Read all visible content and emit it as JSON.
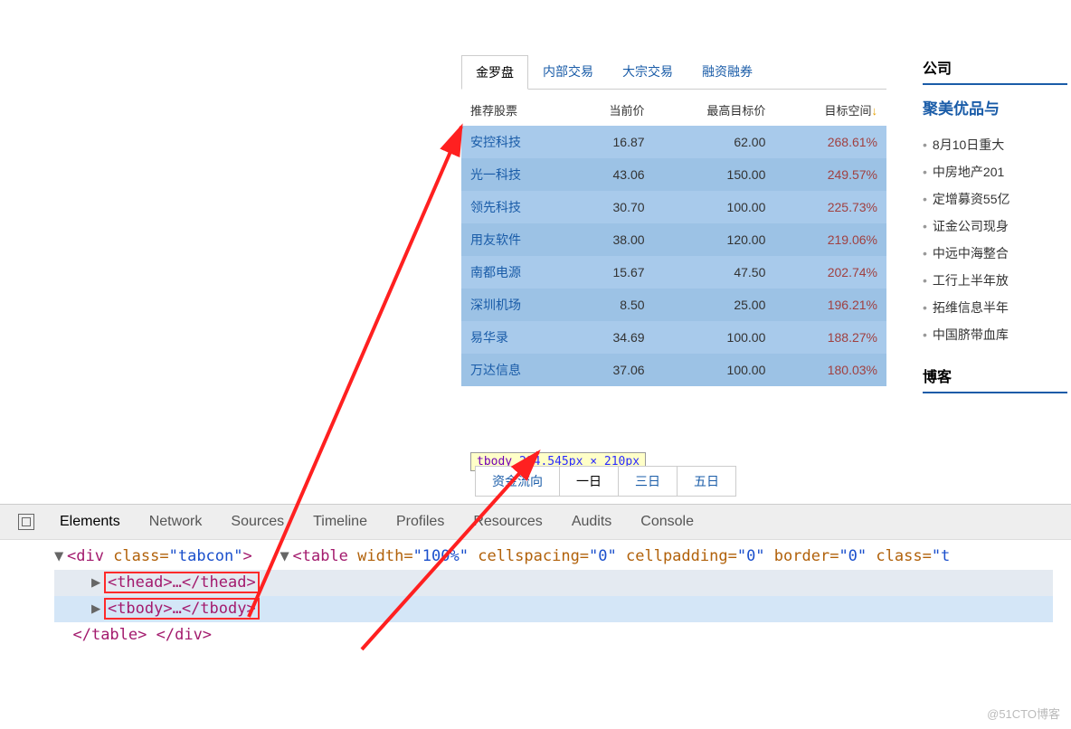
{
  "tabs": [
    "金罗盘",
    "内部交易",
    "大宗交易",
    "融资融券"
  ],
  "activeTab": 0,
  "table": {
    "headers": [
      "推荐股票",
      "当前价",
      "最高目标价",
      "目标空间"
    ],
    "rows": [
      {
        "name": "安控科技",
        "price": "16.87",
        "target": "62.00",
        "space": "268.61%"
      },
      {
        "name": "光一科技",
        "price": "43.06",
        "target": "150.00",
        "space": "249.57%"
      },
      {
        "name": "领先科技",
        "price": "30.70",
        "target": "100.00",
        "space": "225.73%"
      },
      {
        "name": "用友软件",
        "price": "38.00",
        "target": "120.00",
        "space": "219.06%"
      },
      {
        "name": "南都电源",
        "price": "15.67",
        "target": "47.50",
        "space": "202.74%"
      },
      {
        "name": "深圳机场",
        "price": "8.50",
        "target": "25.00",
        "space": "196.21%"
      },
      {
        "name": "易华录",
        "price": "34.69",
        "target": "100.00",
        "space": "188.27%"
      },
      {
        "name": "万达信息",
        "price": "37.06",
        "target": "100.00",
        "space": "180.03%"
      }
    ]
  },
  "tooltip": {
    "tag": "tbody",
    "dims": "284.545px × 210px"
  },
  "bottomTabs": [
    "资金流向",
    "一日",
    "三日",
    "五日"
  ],
  "bottomSel": 1,
  "sidebar": {
    "title1": "公司",
    "headline": "聚美优品与",
    "items": [
      "8月10日重大",
      "中房地产201",
      "定增募资55亿",
      "证金公司现身",
      "中远中海整合",
      "工行上半年放",
      "拓维信息半年",
      "中国脐带血库"
    ],
    "title2": "博客"
  },
  "devtools": {
    "tabs": [
      "Elements",
      "Network",
      "Sources",
      "Timeline",
      "Profiles",
      "Resources",
      "Audits",
      "Console"
    ],
    "active": 0,
    "code": {
      "l1_open": "<div ",
      "l1_attr": "class=",
      "l1_val": "\"tabcon\"",
      "l1_close": ">",
      "l2_open": "<table ",
      "l2_a1": "width=",
      "l2_v1": "\"100%\"",
      "l2_a2": " cellspacing=",
      "l2_v2": "\"0\"",
      "l2_a3": " cellpadding=",
      "l2_v3": "\"0\"",
      "l2_a4": " border=",
      "l2_v4": "\"0\"",
      "l2_a5": " class=",
      "l2_v5": "\"t",
      "l2_close": "",
      "l3": "<thead>…</thead>",
      "l4": "<tbody>…</tbody>",
      "l5": "</table>",
      "l6": "</div>"
    }
  },
  "watermark": "@51CTO博客"
}
